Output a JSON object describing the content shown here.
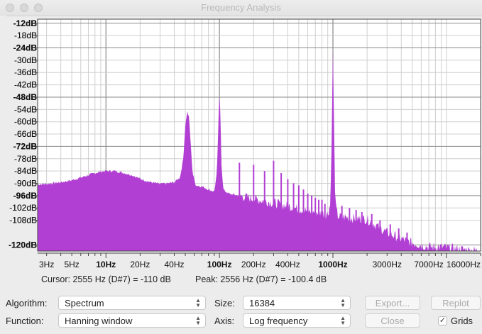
{
  "window": {
    "title": "Frequency Analysis"
  },
  "chart_data": {
    "type": "area",
    "xscale": "log",
    "yunit": "dB",
    "xlim": [
      2.5,
      20000
    ],
    "ylim": [
      -123,
      -10
    ],
    "grid": true,
    "color": "#b23fd4",
    "y_ticks": [
      -12,
      -18,
      -24,
      -30,
      -36,
      -42,
      -48,
      -54,
      -60,
      -66,
      -72,
      -78,
      -84,
      -90,
      -96,
      -102,
      -108,
      -120
    ],
    "y_tick_labels": [
      "-12dB",
      "-18dB",
      "-24dB",
      "-30dB",
      "-36dB",
      "-42dB",
      "-48dB",
      "-54dB",
      "-60dB",
      "-66dB",
      "-72dB",
      "-78dB",
      "-84dB",
      "-90dB",
      "-96dB",
      "-102dB",
      "-108dB",
      "-120dB"
    ],
    "y_bold": [
      -12,
      -24,
      -48,
      -72,
      -96,
      -120
    ],
    "x_ticks": [
      3,
      5,
      10,
      20,
      40,
      100,
      200,
      400,
      1000,
      3000,
      7000,
      16000
    ],
    "x_tick_labels": [
      "3Hz",
      "5Hz",
      "10Hz",
      "20Hz",
      "40Hz",
      "100Hz",
      "200Hz",
      "400Hz",
      "1000Hz",
      "3000Hz",
      "7000Hz",
      "16000Hz"
    ],
    "x_bold": [
      10,
      100,
      1000
    ],
    "series": [
      {
        "envelope": [
          [
            2.5,
            -90.5
          ],
          [
            3,
            -90.3
          ],
          [
            4,
            -89.5
          ],
          [
            5,
            -88.5
          ],
          [
            6,
            -87.2
          ],
          [
            7,
            -86
          ],
          [
            8,
            -85
          ],
          [
            9,
            -84.3
          ],
          [
            10,
            -84
          ],
          [
            12,
            -84
          ],
          [
            14,
            -84.8
          ],
          [
            17,
            -86
          ],
          [
            20,
            -87.8
          ],
          [
            25,
            -89.5
          ],
          [
            30,
            -90.3
          ],
          [
            35,
            -90
          ],
          [
            40,
            -89.5
          ],
          [
            45,
            -87
          ],
          [
            48,
            -78
          ],
          [
            50,
            -62
          ],
          [
            52,
            -55
          ],
          [
            54,
            -58
          ],
          [
            56,
            -72
          ],
          [
            58,
            -85
          ],
          [
            62,
            -91
          ],
          [
            70,
            -91.5
          ],
          [
            80,
            -93
          ],
          [
            90,
            -94
          ],
          [
            95,
            -85
          ],
          [
            98,
            -60
          ],
          [
            100,
            -47
          ],
          [
            102,
            -55
          ],
          [
            104,
            -80
          ],
          [
            108,
            -93
          ],
          [
            120,
            -95
          ],
          [
            150,
            -96
          ],
          [
            200,
            -97.5
          ],
          [
            300,
            -99.5
          ],
          [
            400,
            -101
          ],
          [
            500,
            -102.5
          ],
          [
            600,
            -103.5
          ],
          [
            700,
            -104
          ],
          [
            800,
            -104.5
          ],
          [
            900,
            -105
          ],
          [
            950,
            -100
          ],
          [
            980,
            -60
          ],
          [
            1000,
            -24
          ],
          [
            1020,
            -60
          ],
          [
            1050,
            -100
          ],
          [
            1100,
            -106
          ],
          [
            1500,
            -107
          ],
          [
            2000,
            -107.5
          ],
          [
            3000,
            -114
          ],
          [
            4000,
            -117
          ],
          [
            5000,
            -119
          ],
          [
            6000,
            -120
          ],
          [
            7000,
            -121
          ],
          [
            9000,
            -121
          ],
          [
            12000,
            -122
          ],
          [
            20000,
            -123
          ]
        ],
        "spikes": [
          [
            150,
            -80
          ],
          [
            200,
            -81
          ],
          [
            250,
            -84
          ],
          [
            300,
            -79
          ],
          [
            350,
            -85
          ],
          [
            400,
            -88
          ],
          [
            450,
            -90
          ],
          [
            500,
            -91
          ],
          [
            550,
            -93
          ],
          [
            600,
            -95
          ],
          [
            650,
            -96
          ],
          [
            700,
            -97
          ],
          [
            750,
            -98
          ],
          [
            800,
            -98
          ],
          [
            850,
            -100
          ],
          [
            1200,
            -101
          ],
          [
            1400,
            -102
          ],
          [
            1600,
            -103
          ],
          [
            1800,
            -104
          ],
          [
            2200,
            -105
          ],
          [
            2600,
            -108
          ],
          [
            3200,
            -110
          ],
          [
            3800,
            -112
          ],
          [
            4500,
            -114
          ]
        ]
      }
    ]
  },
  "readout": {
    "cursor": "Cursor: 2555 Hz (D#7) = -110 dB",
    "peak": "Peak: 2556 Hz (D#7) = -100.4 dB"
  },
  "controls": {
    "algorithm_label": "Algorithm:",
    "algorithm_value": "Spectrum",
    "function_label": "Function:",
    "function_value": "Hanning window",
    "size_label": "Size:",
    "size_value": "16384",
    "axis_label": "Axis:",
    "axis_value": "Log frequency",
    "export_label": "Export...",
    "replot_label": "Replot",
    "close_label": "Close",
    "grids_label": "Grids",
    "grids_checked": true
  }
}
